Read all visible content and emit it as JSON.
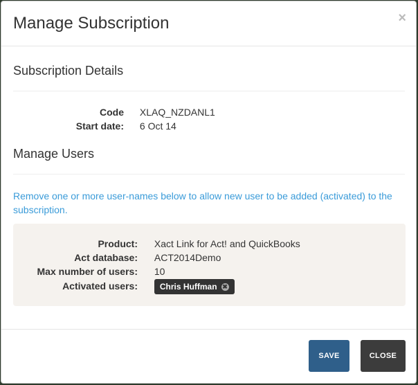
{
  "modal": {
    "title": "Manage Subscription",
    "close_glyph": "×"
  },
  "subscription_details": {
    "heading": "Subscription Details",
    "code_label": "Code",
    "code_value": "XLAQ_NZDANL1",
    "start_label": "Start date:",
    "start_value": "6 Oct 14"
  },
  "manage_users": {
    "heading": "Manage Users",
    "info": "Remove one or more user-names below to allow new user to be added (activated) to the subscription.",
    "product_label": "Product:",
    "product_value": "Xact Link for Act! and QuickBooks",
    "db_label": "Act database:",
    "db_value": "ACT2014Demo",
    "max_label": "Max number of users:",
    "max_value": "10",
    "activated_label": "Activated users:",
    "activated_users": [
      "Chris Huffman"
    ],
    "remove_glyph": "✖"
  },
  "footer": {
    "save_label": "SAVE",
    "close_label": "CLOSE"
  },
  "colors": {
    "info_text": "#3a9bd9",
    "save_button": "#2f5f8a",
    "close_button": "#3c3c3c",
    "panel_bg": "#f5f2ee"
  }
}
